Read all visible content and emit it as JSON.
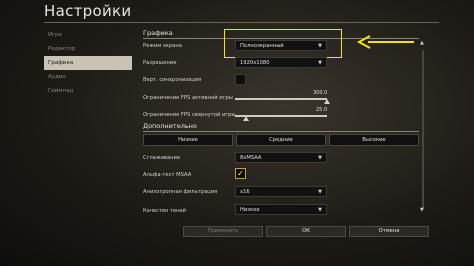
{
  "page": {
    "title": "Настройки"
  },
  "sidebar": {
    "items": [
      {
        "label": "Игра",
        "active": false
      },
      {
        "label": "Редактор",
        "active": false
      },
      {
        "label": "Графика",
        "active": true
      },
      {
        "label": "Аудио",
        "active": false
      },
      {
        "label": "Геймпад",
        "active": false
      }
    ]
  },
  "graphics": {
    "section_title": "Графика",
    "screen_mode": {
      "label": "Режим экрана",
      "value": "Полноэкранный"
    },
    "resolution": {
      "label": "Разрешение",
      "value": "1920x1080"
    },
    "vsync": {
      "label": "Верт. синхронизация",
      "checked": false
    },
    "fps_active": {
      "label": "Ограничение FPS активной игры",
      "value": "300.0",
      "fraction": 1.0
    },
    "fps_minimized": {
      "label": "Ограничение FPS свернутой игры",
      "value": "25.0",
      "fraction": 0.12
    }
  },
  "advanced": {
    "section_title": "Дополнительно",
    "presets": [
      "Низкие",
      "Средние",
      "Высокие"
    ],
    "antialiasing": {
      "label": "Сглаживание",
      "value": "8xMSAA"
    },
    "alpha_test": {
      "label": "Альфа-тест MSAA",
      "checked": true,
      "check_glyph": "✓"
    },
    "anisotropic": {
      "label": "Анизотропная фильтрация",
      "value": "x16"
    },
    "shadow_quality": {
      "label": "Качество теней",
      "value": "Низкое"
    }
  },
  "footer": {
    "apply": "Применить",
    "ok": "ОК",
    "cancel": "Отмена"
  },
  "icons": {
    "dropdown_arrow": "▼",
    "scroll_up": "▲",
    "scroll_down": "▼",
    "annotation_arrow": "arrow-left"
  },
  "colors": {
    "highlight": "#f2e21a",
    "checkbox_accent": "#c89a3a"
  }
}
